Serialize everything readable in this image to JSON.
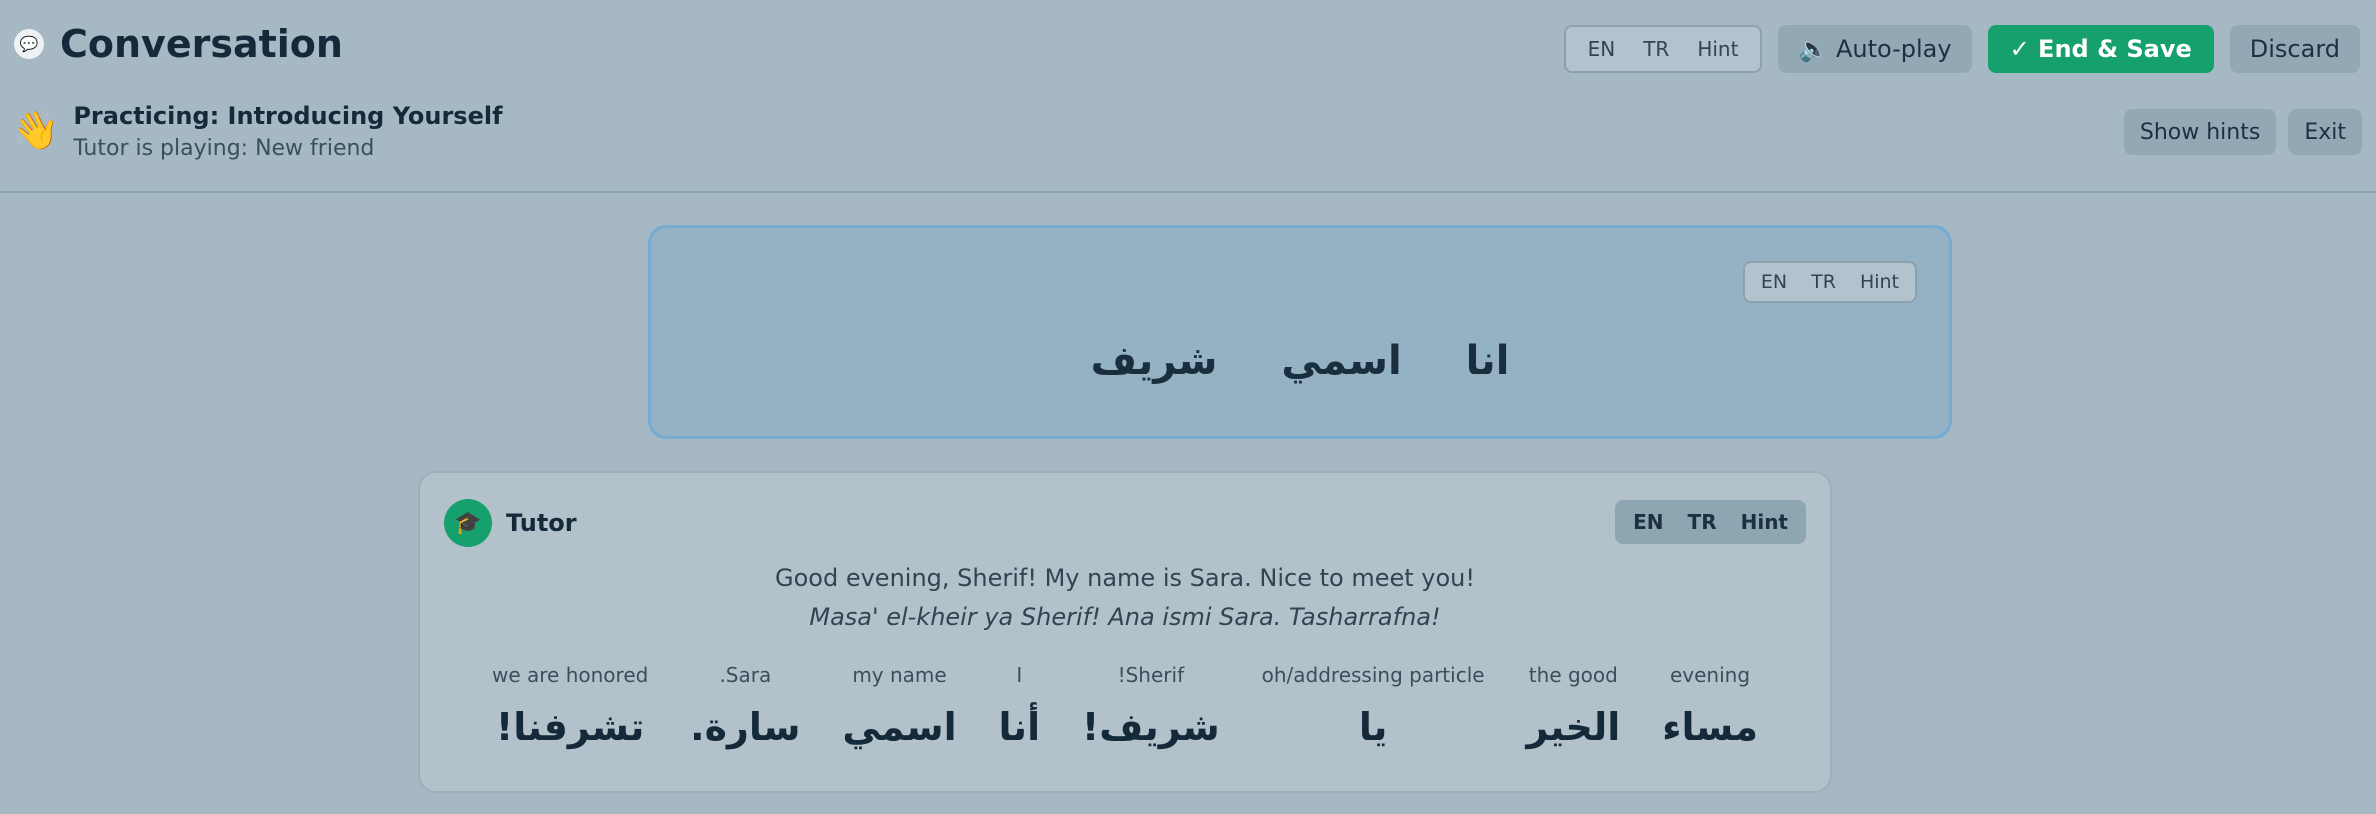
{
  "header": {
    "title": "Conversation",
    "lang_toggle": [
      "EN",
      "TR",
      "Hint"
    ],
    "autoplay_label": "🔈 Auto-play",
    "end_save_label": "✓ End & Save",
    "discard_label": "Discard",
    "scenario_title": "Practicing: Introducing Yourself",
    "scenario_sub": "Tutor is playing: New friend",
    "show_hints_label": "Show hints",
    "exit_label": "Exit"
  },
  "prompt": {
    "toggle": [
      "EN",
      "TR",
      "Hint"
    ],
    "text": "انا اسمي شريف"
  },
  "tutor": {
    "name": "Tutor",
    "toggle": [
      "EN",
      "TR",
      "Hint"
    ],
    "english": "Good evening, Sherif! My name is Sara. Nice to meet you!",
    "transliteration": "Masa' el-kheir ya Sherif! Ana ismi Sara. Tasharrafna!",
    "words": [
      {
        "gloss": "evening",
        "arabic": "مساء"
      },
      {
        "gloss": "the good",
        "arabic": "الخير"
      },
      {
        "gloss": "oh/addressing particle",
        "arabic": "يا"
      },
      {
        "gloss": "!Sherif",
        "arabic": "شريف!"
      },
      {
        "gloss": "I",
        "arabic": "أنا"
      },
      {
        "gloss": "my name",
        "arabic": "اسمي"
      },
      {
        "gloss": ".Sara",
        "arabic": "سارة."
      },
      {
        "gloss": "we are honored",
        "arabic": "تشرفنا!"
      }
    ]
  },
  "colors": {
    "background": "#a6b8c4",
    "accent_green": "#16a06d",
    "prompt_border": "#74acd4"
  },
  "icons": {
    "title": "chat-bubble-icon",
    "scenario": "waving-hand-icon",
    "avatar": "graduation-cap-icon"
  }
}
